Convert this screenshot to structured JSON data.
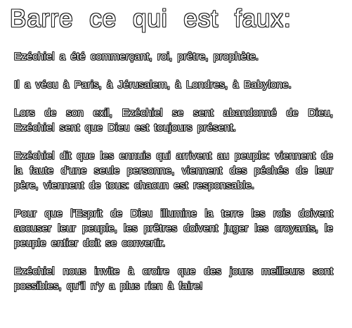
{
  "title": "Barre ce qui est faux:",
  "paragraphs": [
    "Ezéchiel a été commerçant, roi, prêtre, prophète.",
    "Il a vécu à Paris, à Jérusalem, à Londres, à Babylone.",
    "Lors de son exil, Ezéchiel se sent abandonné de Dieu, Ezéchiel sent que Dieu est toujours présent.",
    "Ezéchiel dit que les ennuis qui arrivent au peuple: viennent de la faute d'une seule personne, viennent des péchés de leur père, viennent de tous: chacun est responsable.",
    "Pour que l'Esprit de Dieu illumine la terre les rois doivent accuser leur peuple, les prêtres doivent juger les croyants, le peuple entier doit se convertir.",
    "Ezéchiel nous invite à croire que des jours meilleurs sont possibles, qu'il n'y a plus rien à faire!"
  ]
}
